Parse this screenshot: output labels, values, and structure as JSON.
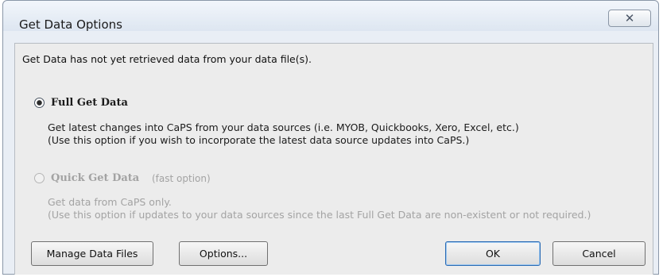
{
  "window": {
    "title": "Get Data Options",
    "close_glyph": "✕"
  },
  "intro_text": "Get Data has not yet retrieved data from your data file(s).",
  "options": {
    "full": {
      "label": "Full Get Data",
      "selected": true,
      "line1": "Get latest changes into CaPS from your data sources (i.e. MYOB, Quickbooks, Xero, Excel, etc.)",
      "line2": "(Use this option if you wish to incorporate the latest data source updates into CaPS.)"
    },
    "quick": {
      "label": "Quick Get Data",
      "hint": "(fast option)",
      "selected": false,
      "enabled": false,
      "line1": "Get data from CaPS only.",
      "line2": "(Use this option if updates to your data sources since the last Full Get Data are non-existent or not required.)"
    }
  },
  "buttons": {
    "manage": "Manage Data Files",
    "options": "Options...",
    "ok": "OK",
    "cancel": "Cancel"
  }
}
